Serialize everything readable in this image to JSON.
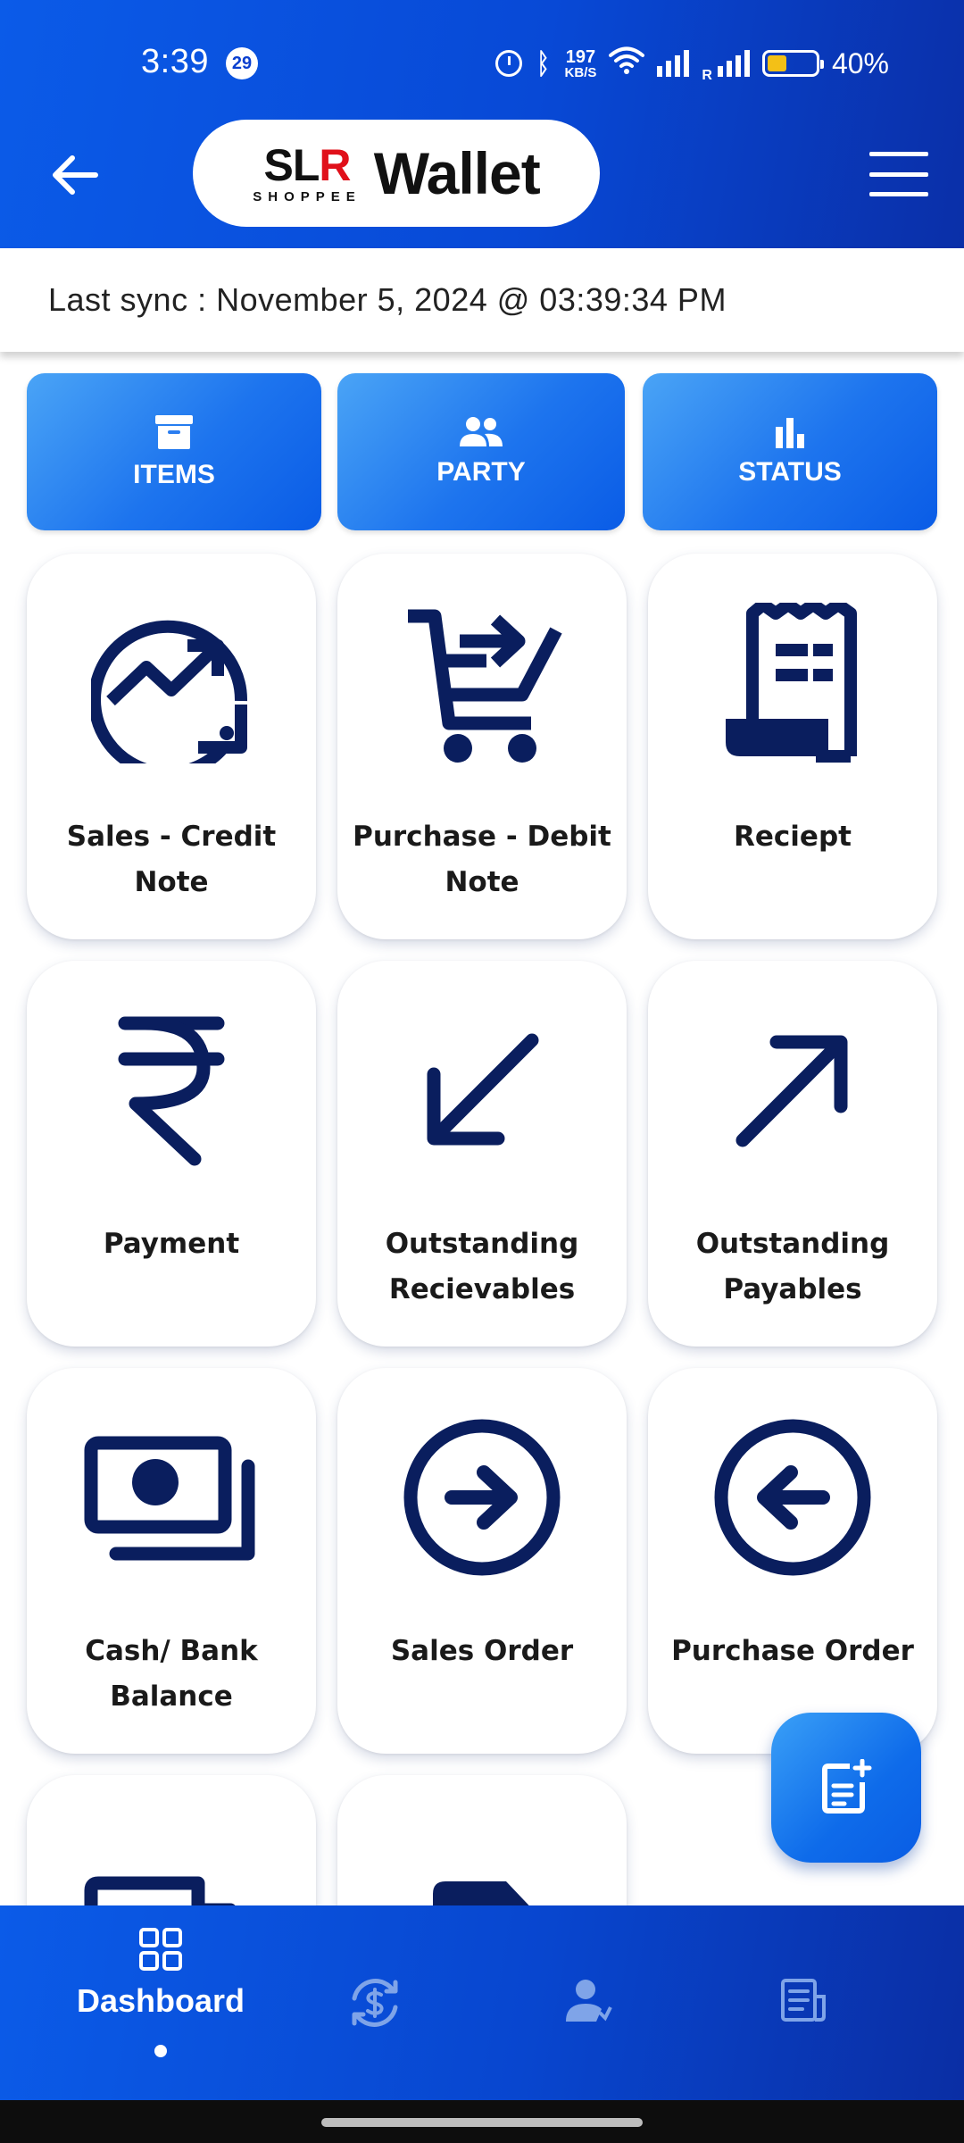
{
  "status_bar": {
    "time": "3:39",
    "notification_count": "29",
    "net_speed_value": "197",
    "net_speed_unit": "KB/S",
    "roaming": "R",
    "battery": "40%"
  },
  "app_bar": {
    "logo_text_1": "S",
    "logo_text_2": "L",
    "logo_text_3": "R",
    "logo_sub": "SHOPPEE",
    "logo_wallet": "Wallet"
  },
  "sync": {
    "text": "Last sync : November 5, 2024 @ 03:39:34 PM"
  },
  "tabs": [
    {
      "label": "ITEMS",
      "icon": "archive-icon"
    },
    {
      "label": "PARTY",
      "icon": "people-icon"
    },
    {
      "label": "STATUS",
      "icon": "bar-chart-icon"
    }
  ],
  "tiles": [
    {
      "label": "Sales - Credit Note",
      "icon": "trending-up-circle-icon"
    },
    {
      "label": "Purchase - Debit Note",
      "icon": "cart-arrow-icon"
    },
    {
      "label": "Reciept",
      "icon": "receipt-icon"
    },
    {
      "label": "Payment",
      "icon": "rupee-icon"
    },
    {
      "label": "Outstanding Recievables",
      "icon": "arrow-down-left-icon"
    },
    {
      "label": "Outstanding Payables",
      "icon": "arrow-up-right-icon"
    },
    {
      "label": "Cash/ Bank Balance",
      "icon": "cash-icon"
    },
    {
      "label": "Sales Order",
      "icon": "arrow-right-circle-icon"
    },
    {
      "label": "Purchase Order",
      "icon": "arrow-left-circle-icon"
    },
    {
      "label": "",
      "icon": "truck-icon"
    },
    {
      "label": "",
      "icon": "document-icon"
    }
  ],
  "bottom_nav": {
    "dashboard_label": "Dashboard",
    "items": [
      "dashboard-icon",
      "sync-rupee-icon",
      "person-icon",
      "report-icon"
    ]
  },
  "colors": {
    "header_blue": "#0b5be8",
    "icon_navy": "#0a1e5e",
    "accent_blue": "#1d74ee"
  }
}
